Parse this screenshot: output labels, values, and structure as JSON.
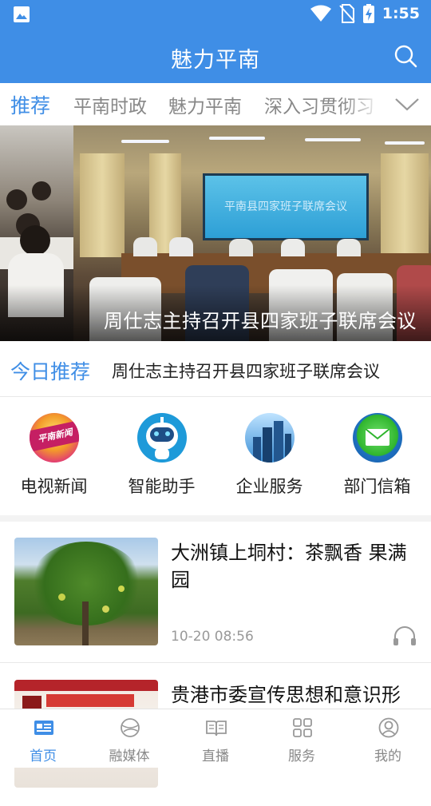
{
  "status_bar": {
    "time": "1:55"
  },
  "header": {
    "title": "魅力平南"
  },
  "tabs": [
    {
      "label": "推荐"
    },
    {
      "label": "平南时政"
    },
    {
      "label": "魅力平南"
    },
    {
      "label": "深入习贯彻习"
    }
  ],
  "banner": {
    "caption": "周仕志主持召开县四家班子联席会议",
    "screen_text": "平南县四家班子联席会议"
  },
  "today": {
    "label": "今日推荐",
    "headline": "周仕志主持召开县四家班子联席会议"
  },
  "quick_links": [
    {
      "label": "电视新闻",
      "icon": "tv-news-logo-icon",
      "logo_text": "平南新闻"
    },
    {
      "label": "智能助手",
      "icon": "robot-assistant-icon"
    },
    {
      "label": "企业服务",
      "icon": "city-buildings-icon"
    },
    {
      "label": "部门信箱",
      "icon": "mail-envelope-icon"
    }
  ],
  "news": [
    {
      "title": "大洲镇上垌村：茶飘香 果满园",
      "time": "10-20 08:56"
    },
    {
      "title": "贵港市委宣传思想和意识形",
      "time": ""
    }
  ],
  "bottom_nav": [
    {
      "label": "首页",
      "icon": "news-home-icon",
      "active": true
    },
    {
      "label": "融媒体",
      "icon": "globe-icon",
      "active": false
    },
    {
      "label": "直播",
      "icon": "open-book-icon",
      "active": false
    },
    {
      "label": "服务",
      "icon": "grid-squares-icon",
      "active": false
    },
    {
      "label": "我的",
      "icon": "user-profile-icon",
      "active": false
    }
  ],
  "colors": {
    "primary": "#3f8ee6",
    "inactive": "#888888"
  }
}
